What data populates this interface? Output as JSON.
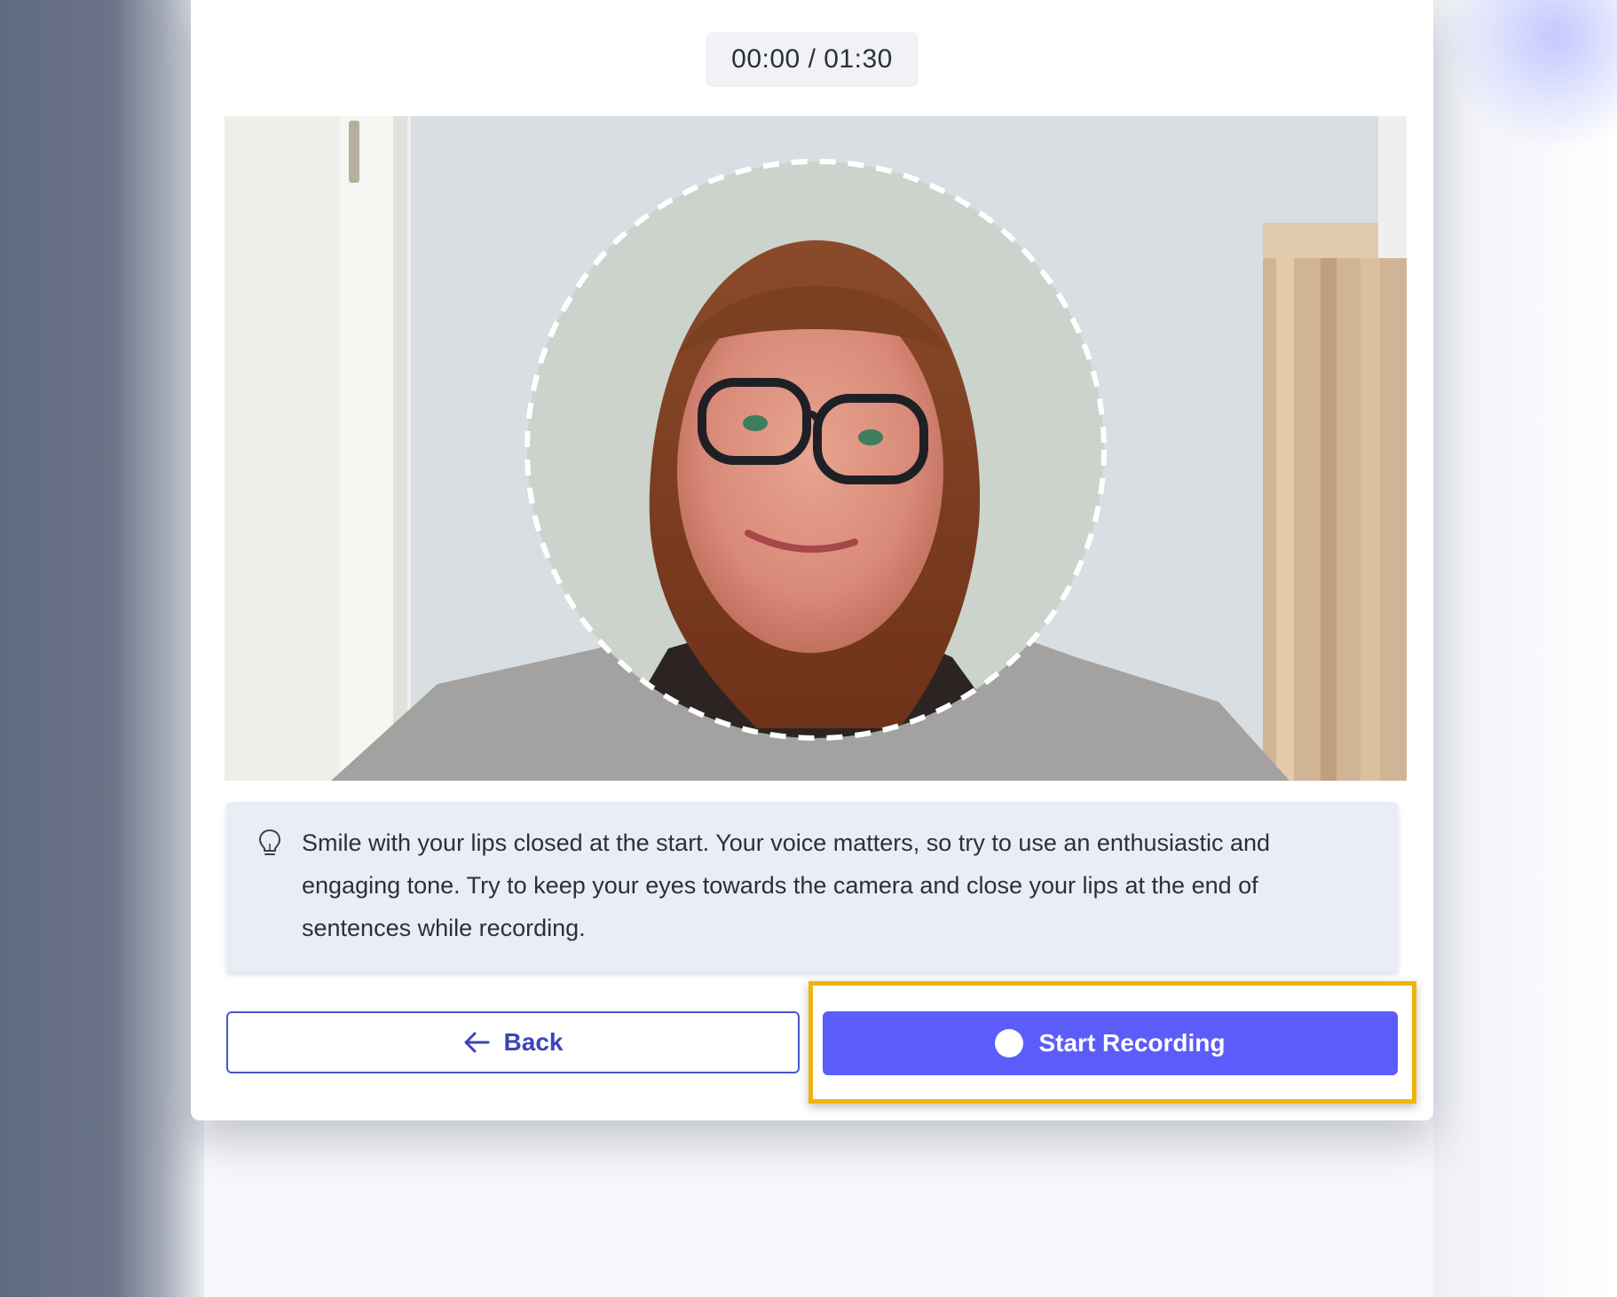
{
  "timer": {
    "elapsed": "00:00",
    "separator": " / ",
    "total": "01:30"
  },
  "camera": {
    "label": "Camera preview"
  },
  "tip": {
    "icon": "lightbulb-icon",
    "text": "Smile with your lips closed at the start. Your voice matters, so try to use an enthusiastic and engaging tone. Try to keep your eyes towards the camera and close your lips at the end of sentences while recording."
  },
  "buttons": {
    "back_label": "Back",
    "back_icon": "arrow-left-icon",
    "record_label": "Start Recording",
    "record_icon": "record-dot-icon"
  },
  "colors": {
    "primary": "#5c5cfb",
    "outline": "#4d55d0",
    "highlight": "#efb40c",
    "tip_background": "#eaedf5"
  }
}
